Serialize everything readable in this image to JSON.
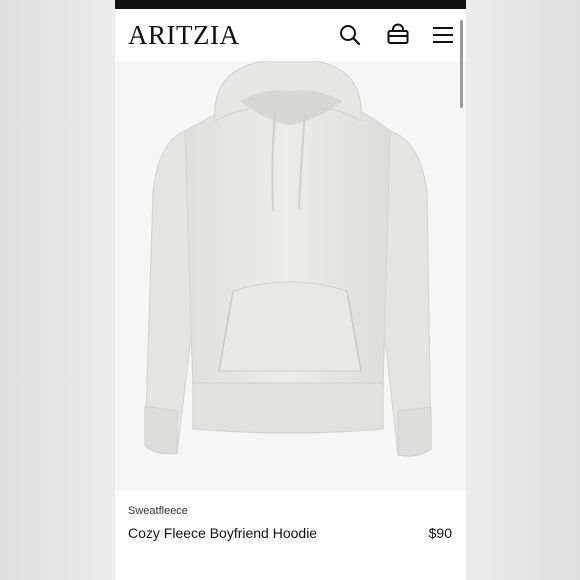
{
  "header": {
    "logo": "ARITZIA",
    "icons": [
      "search-icon",
      "cart-icon",
      "menu-icon"
    ]
  },
  "product": {
    "brand": "Sweatfleece",
    "name": "Cozy Fleece Boyfriend Hoodie",
    "price": "$90",
    "garment_color": "#ebebea"
  },
  "colors": {
    "status_bar": "#111111",
    "text": "#111111",
    "background": "#ffffff"
  }
}
